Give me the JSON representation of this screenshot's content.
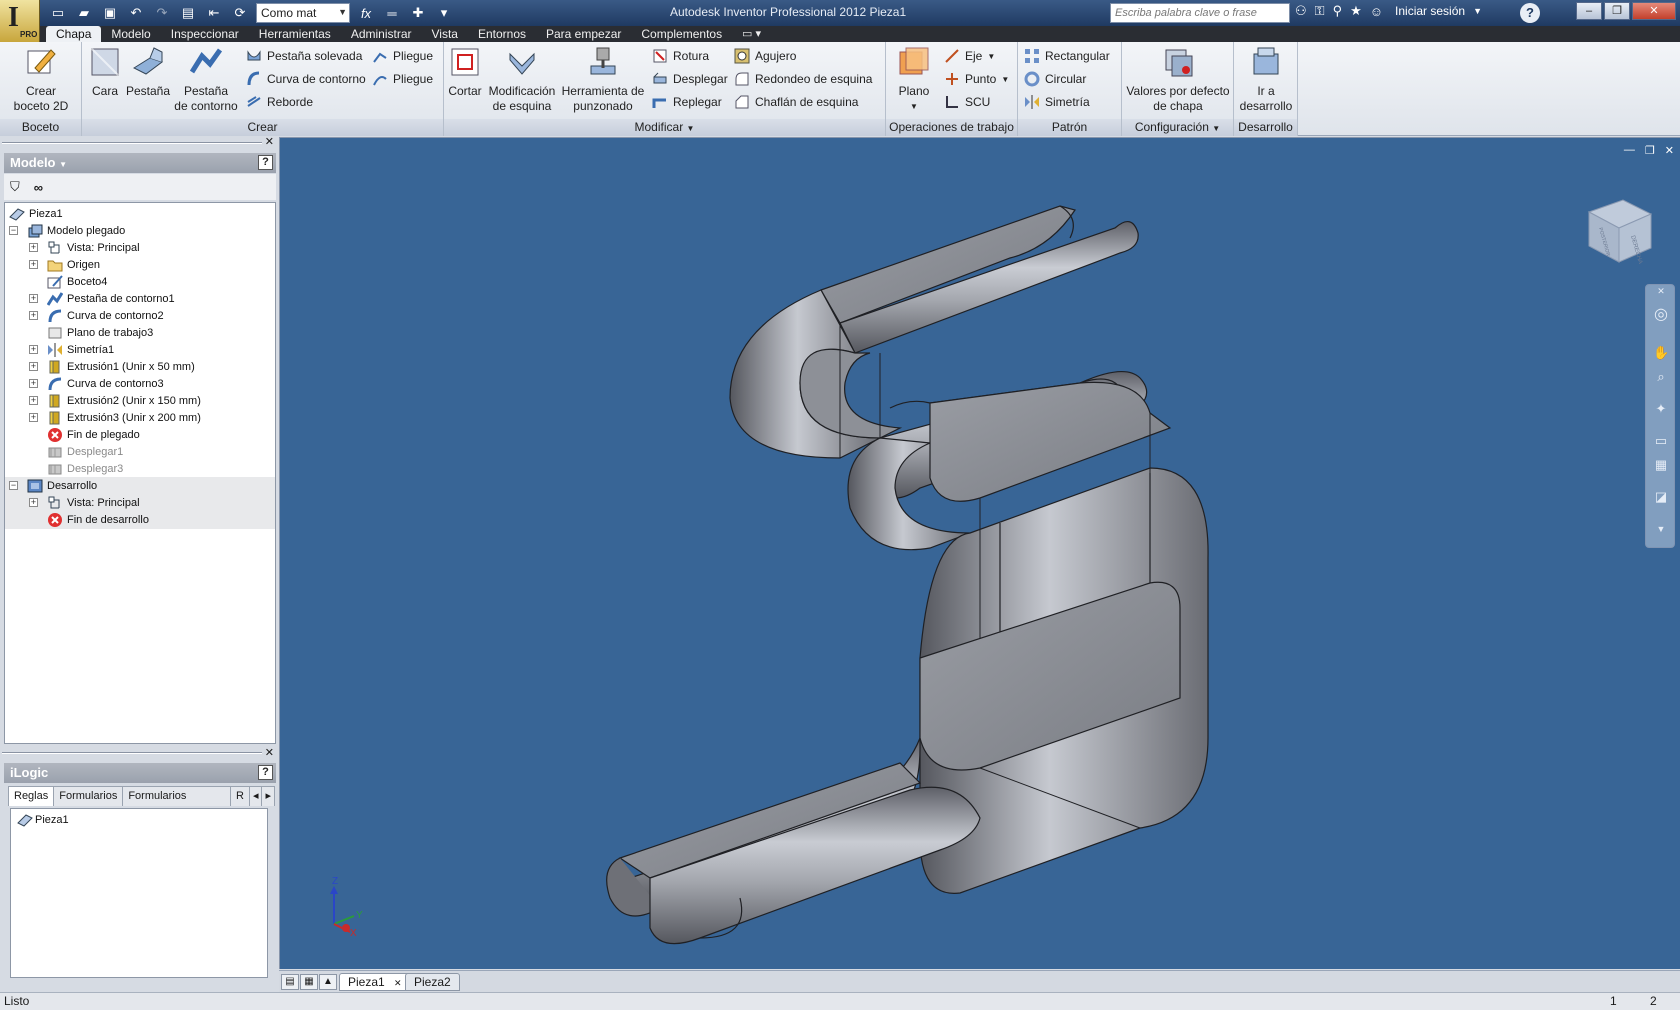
{
  "app": {
    "title": "Autodesk Inventor Professional 2012   Pieza1",
    "pro_badge": "PRO",
    "material": "Como mat",
    "search_placeholder": "Escriba palabra clave o frase",
    "signin": "Iniciar sesión",
    "help": "?"
  },
  "ribbon_tabs": [
    "Chapa",
    "Modelo",
    "Inspeccionar",
    "Herramientas",
    "Administrar",
    "Vista",
    "Entornos",
    "Para empezar",
    "Complementos"
  ],
  "ribbon": {
    "boceto": {
      "label": "Boceto",
      "crear_boceto": "Crear\nboceto 2D"
    },
    "crear": {
      "label": "Crear",
      "cara": "Cara",
      "pestana": "Pestaña",
      "pestana_contorno": "Pestaña\nde contorno",
      "pestana_solevada": "Pestaña solevada",
      "curva_contorno": "Curva de contorno",
      "reborde": "Reborde",
      "pliegue1": "Pliegue",
      "pliegue2": "Pliegue"
    },
    "modificar": {
      "label": "Modificar",
      "cortar": "Cortar",
      "mod_esquina": "Modificación\nde esquina",
      "herramienta_punzonado": "Herramienta de\npunzonado",
      "rotura": "Rotura",
      "desplegar": "Desplegar",
      "replegar": "Replegar",
      "agujero": "Agujero",
      "redondeo": "Redondeo de esquina",
      "chaflan": "Chaflán de esquina"
    },
    "operaciones": {
      "label": "Operaciones de trabajo",
      "plano": "Plano",
      "eje": "Eje",
      "punto": "Punto",
      "scu": "SCU"
    },
    "patron": {
      "label": "Patrón",
      "rectangular": "Rectangular",
      "circular": "Circular",
      "simetria": "Simetría"
    },
    "configuracion": {
      "label": "Configuración",
      "valores": "Valores por defecto\nde chapa"
    },
    "desarrollo": {
      "label": "Desarrollo",
      "ir_desarrollo": "Ir a\ndesarrollo"
    }
  },
  "browser": {
    "title": "Modelo",
    "help": "?",
    "tree": [
      {
        "label": "Pieza1",
        "level": 0,
        "icon": "part-icon",
        "expander": "",
        "dim": false,
        "shaded": false
      },
      {
        "label": "Modelo plegado",
        "level": 1,
        "icon": "folded-model-icon",
        "expander": "−",
        "dim": false,
        "shaded": false
      },
      {
        "label": "Vista: Principal",
        "level": 2,
        "icon": "view-rep-icon",
        "expander": "+",
        "dim": false,
        "shaded": false
      },
      {
        "label": "Origen",
        "level": 2,
        "icon": "folder-icon",
        "expander": "+",
        "dim": false,
        "shaded": false
      },
      {
        "label": "Boceto4",
        "level": 2,
        "icon": "sketch-icon",
        "expander": "",
        "dim": false,
        "shaded": false
      },
      {
        "label": "Pestaña de contorno1",
        "level": 2,
        "icon": "contour-flange-icon",
        "expander": "+",
        "dim": false,
        "shaded": false
      },
      {
        "label": "Curva de contorno2",
        "level": 2,
        "icon": "contour-roll-icon",
        "expander": "+",
        "dim": false,
        "shaded": false
      },
      {
        "label": "Plano de trabajo3",
        "level": 2,
        "icon": "work-plane-icon",
        "expander": "",
        "dim": false,
        "shaded": false
      },
      {
        "label": "Simetría1",
        "level": 2,
        "icon": "mirror-icon",
        "expander": "+",
        "dim": false,
        "shaded": false
      },
      {
        "label": "Extrusión1 (Unir x 50 mm)",
        "level": 2,
        "icon": "extrusion-icon",
        "expander": "+",
        "dim": false,
        "shaded": false
      },
      {
        "label": "Curva de contorno3",
        "level": 2,
        "icon": "contour-roll-icon",
        "expander": "+",
        "dim": false,
        "shaded": false
      },
      {
        "label": "Extrusión2 (Unir x 150 mm)",
        "level": 2,
        "icon": "extrusion-icon",
        "expander": "+",
        "dim": false,
        "shaded": false
      },
      {
        "label": "Extrusión3 (Unir x 200 mm)",
        "level": 2,
        "icon": "extrusion-icon",
        "expander": "+",
        "dim": false,
        "shaded": false
      },
      {
        "label": "Fin de plegado",
        "level": 2,
        "icon": "end-of-folded-icon",
        "expander": "",
        "dim": false,
        "shaded": false
      },
      {
        "label": "Desplegar1",
        "level": 2,
        "icon": "unfold-icon",
        "expander": "",
        "dim": true,
        "shaded": false
      },
      {
        "label": "Desplegar3",
        "level": 2,
        "icon": "unfold-icon",
        "expander": "",
        "dim": true,
        "shaded": false
      },
      {
        "label": "Desarrollo",
        "level": 1,
        "icon": "flat-pattern-icon",
        "expander": "−",
        "dim": false,
        "shaded": true
      },
      {
        "label": "Vista: Principal",
        "level": 2,
        "icon": "view-rep-icon",
        "expander": "+",
        "dim": false,
        "shaded": true
      },
      {
        "label": "Fin de desarrollo",
        "level": 2,
        "icon": "end-of-flat-icon",
        "expander": "",
        "dim": false,
        "shaded": true
      }
    ]
  },
  "ilogic": {
    "title": "iLogic",
    "help": "?",
    "tabs": [
      "Reglas",
      "Formularios",
      "Formularios globales",
      "R"
    ],
    "tree_item": "Pieza1"
  },
  "viewport": {
    "background": "#386596",
    "viewcube_label": "DERECHA",
    "viewcube_side": "POSTERIOR",
    "axes": {
      "z": "Z",
      "y": "Y",
      "x": "X"
    }
  },
  "doc_tabs": [
    "Pieza1",
    "Pieza2"
  ],
  "status": {
    "text": "Listo",
    "n1": "1",
    "n2": "2"
  }
}
